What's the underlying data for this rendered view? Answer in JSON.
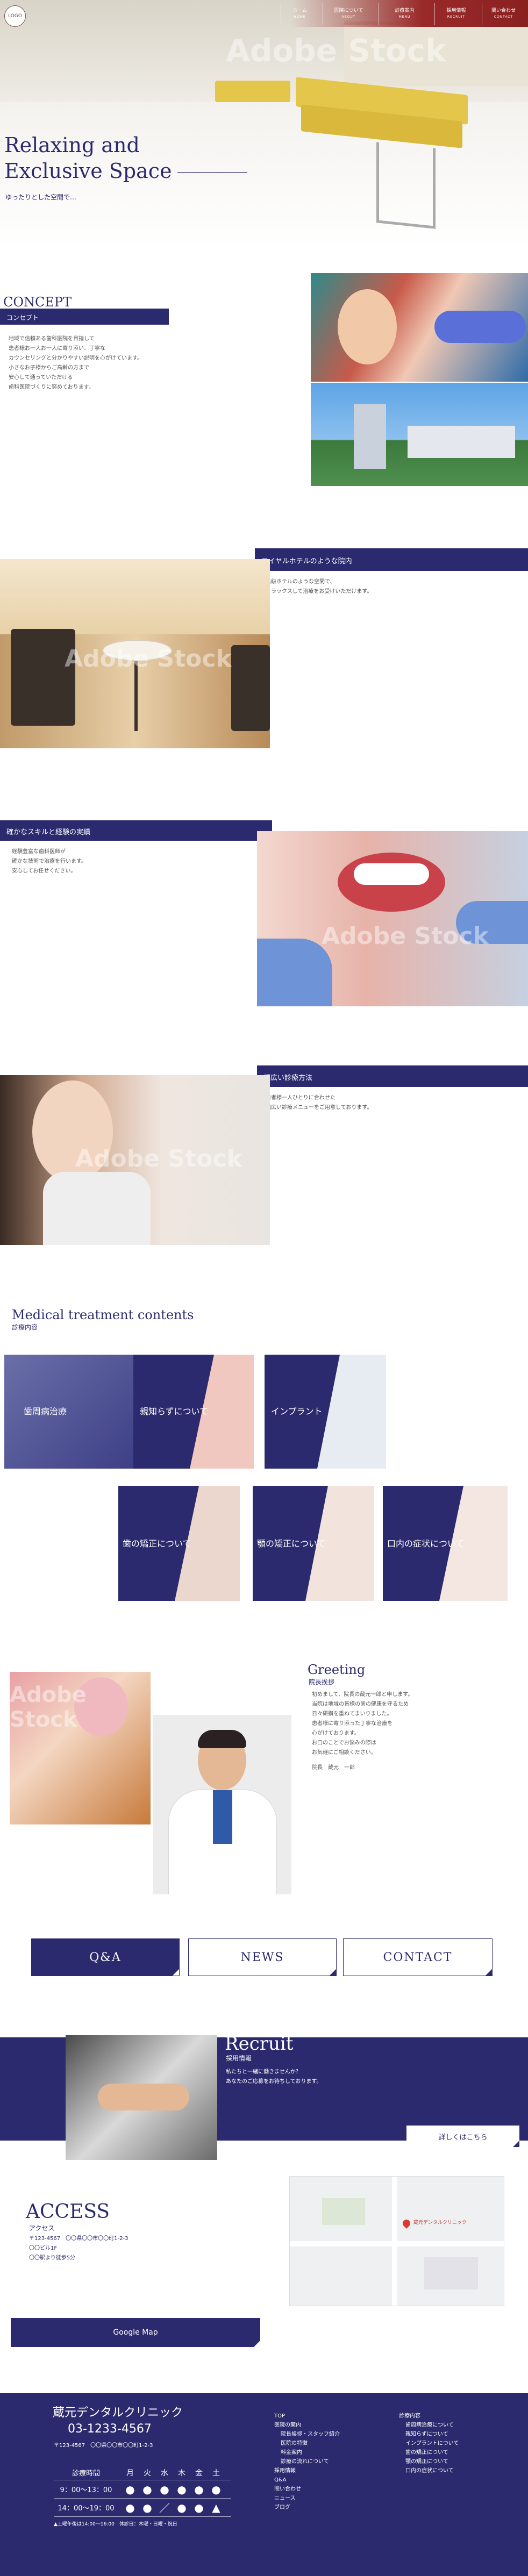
{
  "header": {
    "logo": "LOGO",
    "nav": [
      {
        "jp": "ホーム",
        "en": "HOME"
      },
      {
        "jp": "医院について",
        "en": "ABOUT"
      },
      {
        "jp": "診療案内",
        "en": "MENU"
      },
      {
        "jp": "採用情報",
        "en": "RECRUIT"
      },
      {
        "jp": "問い合わせ",
        "en": "CONTACT"
      }
    ]
  },
  "hero": {
    "title_line1": "Relaxing and",
    "title_line2": "Exclusive Space",
    "subtitle": "ゆったりとした空間で…",
    "watermark": "Adobe Stock"
  },
  "concept": {
    "en": "CONCEPT",
    "jp": "コンセプト",
    "body": [
      "地域で信頼ある歯科医院を目指して",
      "患者様お一人お一人に寄り添い、丁寧な",
      "カウンセリングと分かりやすい説明を心がけています。",
      "小さなお子様からご高齢の方まで",
      "安心して通っていただける",
      "歯科医院づくりに努めております。"
    ]
  },
  "hotel": {
    "title": "ロイヤルホテルのような院内",
    "body": [
      "高級ホテルのような空間で、",
      "リラックスして治療をお受けいただけます。"
    ]
  },
  "skill": {
    "title": "確かなスキルと経験の実績",
    "body": [
      "経験豊富な歯科医師が",
      "確かな技術で治療を行います。",
      "安心してお任せください。"
    ]
  },
  "menu_wide": {
    "title": "幅広い診療方法",
    "body": [
      "患者様一人ひとりに合わせた",
      "幅広い診療メニューをご用意しております。"
    ]
  },
  "treatment": {
    "en": "Medical treatment contents",
    "jp": "診療内容",
    "tiles": [
      "歯周病治療",
      "親知らずについて",
      "インプラント",
      "歯の矯正について",
      "顎の矯正について",
      "口内の症状について"
    ]
  },
  "greeting": {
    "en": "Greeting",
    "jp": "院長挨拶",
    "body": [
      "初めまして、院長の蔵元一郎と申します。",
      "当院は地域の皆様の歯の健康を守るため",
      "日々研鑽を重ねてまいりました。",
      "患者様に寄り添った丁寧な治療を",
      "心がけております。",
      "お口のことでお悩みの際は",
      "お気軽にご相談ください。"
    ],
    "sign": "院長　蔵元　一郎"
  },
  "buttons": {
    "qa": "Q&A",
    "news": "NEWS",
    "contact": "CONTACT"
  },
  "recruit": {
    "en": "Recruit",
    "jp": "採用情報",
    "body": [
      "私たちと一緒に働きませんか？",
      "あなたのご応募をお待ちしております。"
    ],
    "link": "詳しくはこちら"
  },
  "access": {
    "en": "ACCESS",
    "jp": "アクセス",
    "postal": "〒123-4567　〇〇県〇〇市〇〇町1-2-3",
    "building": "〇〇ビル1F",
    "station": "〇〇駅より徒歩5分",
    "map_button": "Google Map",
    "map_pin": "蔵元デンタルクリニック"
  },
  "footer": {
    "clinic": "蔵元デンタルクリニック",
    "tel": "03-1233-4567",
    "address": "〒123-4567　〇〇県〇〇市〇〇町1-2-3",
    "hours_label": "診療時間",
    "days": [
      "月",
      "火",
      "水",
      "木",
      "金",
      "土"
    ],
    "rows": [
      {
        "time": "9：00～13：00",
        "marks": [
          "●",
          "●",
          "●",
          "●",
          "●",
          "●"
        ]
      },
      {
        "time": "14：00～19：00",
        "marks": [
          "●",
          "●",
          "／",
          "●",
          "●",
          "▲"
        ]
      }
    ],
    "note": "▲土曜午後は14:00～16:00　休診日：木曜・日曜・祝日",
    "col1": [
      "TOP",
      "医院の案内",
      "院長挨拶・スタッフ紹介",
      "医院の特徴",
      "料金案内",
      "診療の流れについて",
      "採用情報",
      "Q&A",
      "問い合わせ",
      "ニュース",
      "ブログ"
    ],
    "col2": [
      "診療内容",
      "歯周病治療について",
      "親知らずについて",
      "インプラントについて",
      "歯の矯正について",
      "顎の矯正について",
      "口内の症状について"
    ]
  }
}
